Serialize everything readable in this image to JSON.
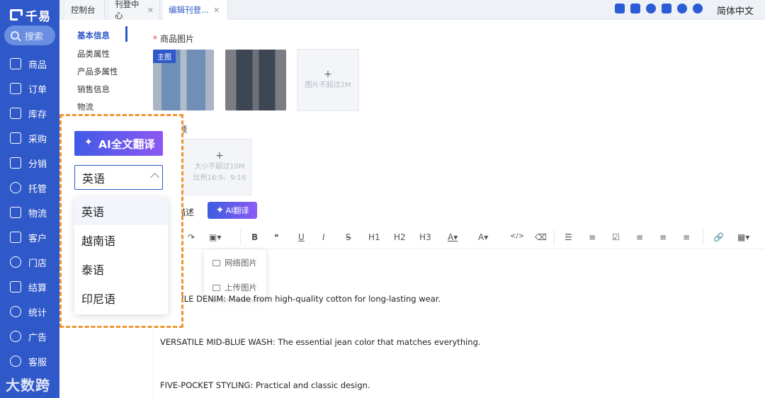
{
  "sidebar": {
    "logo": "千易",
    "search_label": "搜索",
    "items": [
      {
        "label": "商品",
        "icon": "shop-icon"
      },
      {
        "label": "订单",
        "icon": "order-icon"
      },
      {
        "label": "库存",
        "icon": "warehouse-icon"
      },
      {
        "label": "采购",
        "icon": "cart-icon"
      },
      {
        "label": "分销",
        "icon": "distribution-icon"
      },
      {
        "label": "托管",
        "icon": "hosting-icon"
      },
      {
        "label": "物流",
        "icon": "truck-icon"
      },
      {
        "label": "客户",
        "icon": "customer-icon"
      },
      {
        "label": "门店",
        "icon": "store-icon"
      },
      {
        "label": "结算",
        "icon": "settlement-icon"
      },
      {
        "label": "统计",
        "icon": "chart-icon"
      },
      {
        "label": "广告",
        "icon": "ad-icon"
      },
      {
        "label": "客服",
        "icon": "headset-icon"
      }
    ]
  },
  "watermark": "大数跨境",
  "tabs": [
    {
      "label": "控制台",
      "closable": false
    },
    {
      "label": "刊登中心",
      "closable": true
    },
    {
      "label": "编辑刊登...",
      "closable": true,
      "active": true
    }
  ],
  "header": {
    "language": "简体中文",
    "icons": [
      "note-icon",
      "download-icon",
      "bell-icon",
      "expand-icon",
      "help-icon",
      "service-icon"
    ]
  },
  "subnav": {
    "items": [
      "基本信息",
      "品类属性",
      "产品多属性",
      "销售信息",
      "物流"
    ],
    "active_index": 0
  },
  "product_images": {
    "label": "商品图片",
    "main_badge": "主图",
    "upload_hint": "图片不超过2M",
    "plus": "+"
  },
  "video": {
    "label_partial": "频",
    "hint_line1": "大小不超过10M",
    "hint_line2": "比例16:9、9:16",
    "plus": "+"
  },
  "description": {
    "label_partial": "描述",
    "ai_button": "AI翻译"
  },
  "toolbar": {
    "items": [
      "B",
      "❝",
      "U",
      "I",
      "S",
      "H1",
      "H2",
      "H3",
      "A▾",
      "A▾",
      "</>",
      "⌫"
    ]
  },
  "image_menu": {
    "items": [
      "网络图片",
      "上传图片"
    ]
  },
  "editor": {
    "lines": [
      "ABLE DENIM: Made from high-quality cotton for long-lasting wear.",
      "VERSATILE MID-BLUE WASH: The essential jean color that matches everything.",
      "FIVE-POCKET STYLING: Practical and classic design."
    ]
  },
  "translate_panel": {
    "ai_button": "AI全文翻译",
    "selected_language": "英语",
    "options": [
      "英语",
      "越南语",
      "泰语",
      "印尼语"
    ],
    "highlight_color": "#f0952f"
  }
}
